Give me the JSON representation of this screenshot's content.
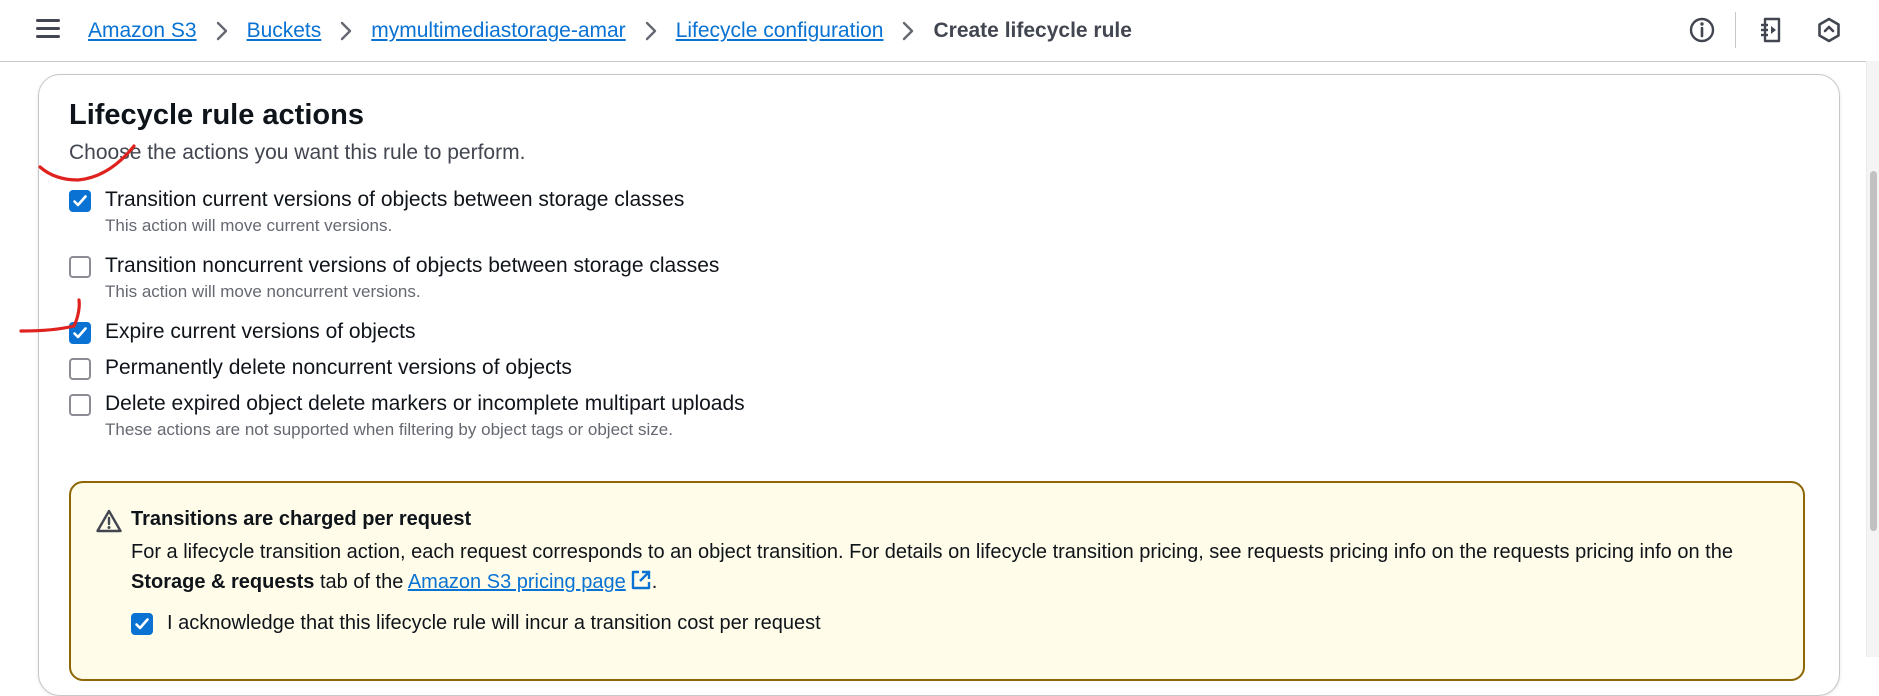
{
  "breadcrumb": {
    "items": [
      "Amazon S3",
      "Buckets",
      "mymultimediastorage-amar",
      "Lifecycle configuration"
    ],
    "current": "Create lifecycle rule"
  },
  "header_icons": [
    "info-icon",
    "notifications-panel-icon",
    "settings-hexagon-icon"
  ],
  "section": {
    "title": "Lifecycle rule actions",
    "description": "Choose the actions you want this rule to perform."
  },
  "actions": [
    {
      "label": "Transition current versions of objects between storage classes",
      "description": "This action will move current versions.",
      "checked": true
    },
    {
      "label": "Transition noncurrent versions of objects between storage classes",
      "description": "This action will move noncurrent versions.",
      "checked": false
    },
    {
      "label": "Expire current versions of objects",
      "description": "",
      "checked": true
    },
    {
      "label": "Permanently delete noncurrent versions of objects",
      "description": "",
      "checked": false
    },
    {
      "label": "Delete expired object delete markers or incomplete multipart uploads",
      "description": "These actions are not supported when filtering by object tags or object size.",
      "checked": false
    }
  ],
  "alert": {
    "title": "Transitions are charged per request",
    "body_prefix": "For a lifecycle transition action, each request corresponds to an object transition. For details on lifecycle transition pricing, see requests pricing info on the requests pricing info on the ",
    "body_bold": "Storage & requests",
    "body_mid": " tab of the ",
    "link": "Amazon S3 pricing page",
    "body_end": ".",
    "acknowledge_label": "I acknowledge that this lifecycle rule will incur a transition cost per request",
    "acknowledge_checked": true
  },
  "colors": {
    "link": "#0972d3",
    "checkbox_checked": "#0972d3",
    "warning_border": "#8d6605",
    "warning_bg": "#fffce9",
    "annotation": "#e0221f"
  }
}
